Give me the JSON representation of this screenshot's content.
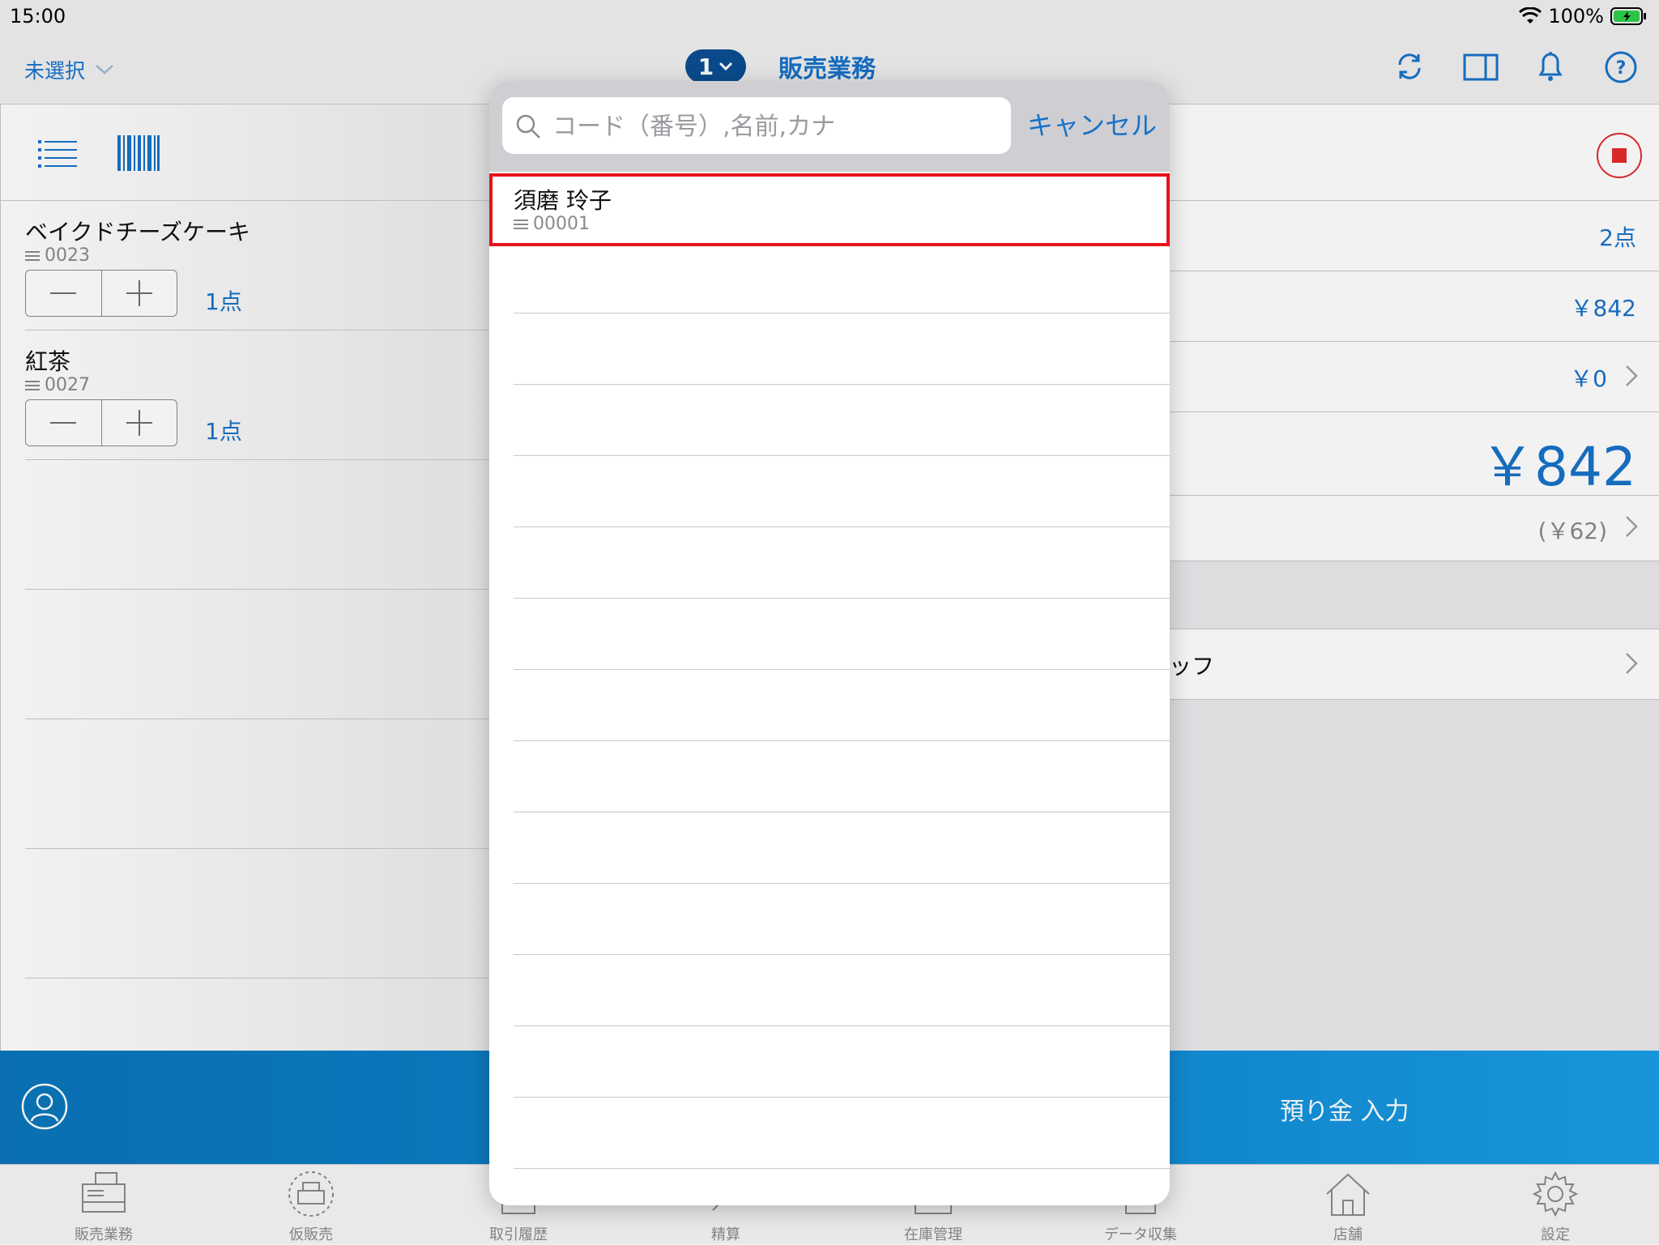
{
  "status": {
    "time": "15:00",
    "battery": "100%"
  },
  "nav": {
    "store_selector": "未選択",
    "register_number": "1",
    "title": "販売業務",
    "icons": [
      "sync-icon",
      "panel-icon",
      "bell-icon",
      "help-icon"
    ]
  },
  "left": {
    "items": [
      {
        "name": "ベイクドチーズケーキ",
        "code": "0023",
        "qty": "1点"
      },
      {
        "name": "紅茶",
        "code": "0027",
        "qty": "1点"
      }
    ]
  },
  "right": {
    "count": "2点",
    "subtotal": "￥842",
    "discount": "￥0",
    "total": "￥842",
    "tax": "(￥62)",
    "staff_label": "ッフ"
  },
  "action": {
    "deposit": "預り金 入力"
  },
  "tabs": [
    {
      "label": "販売業務",
      "icon": "register-icon"
    },
    {
      "label": "仮販売",
      "icon": "temp-register-icon"
    },
    {
      "label": "取引履歴",
      "icon": "history-icon"
    },
    {
      "label": "精算",
      "icon": "settlement-icon"
    },
    {
      "label": "在庫管理",
      "icon": "inventory-icon"
    },
    {
      "label": "データ収集",
      "icon": "data-collection-icon"
    },
    {
      "label": "店舗",
      "icon": "store-icon"
    },
    {
      "label": "設定",
      "icon": "gear-icon"
    }
  ],
  "popover": {
    "search_placeholder": "コード（番号）,名前,カナ",
    "search_value": "",
    "cancel": "キャンセル",
    "results": [
      {
        "name": "須磨 玲子",
        "code": "00001",
        "highlighted": true
      }
    ]
  },
  "colors": {
    "accent": "#1872c8",
    "highlight": "#e8121a",
    "stop": "#e32b2b",
    "action_bar": "#0d85cf"
  }
}
